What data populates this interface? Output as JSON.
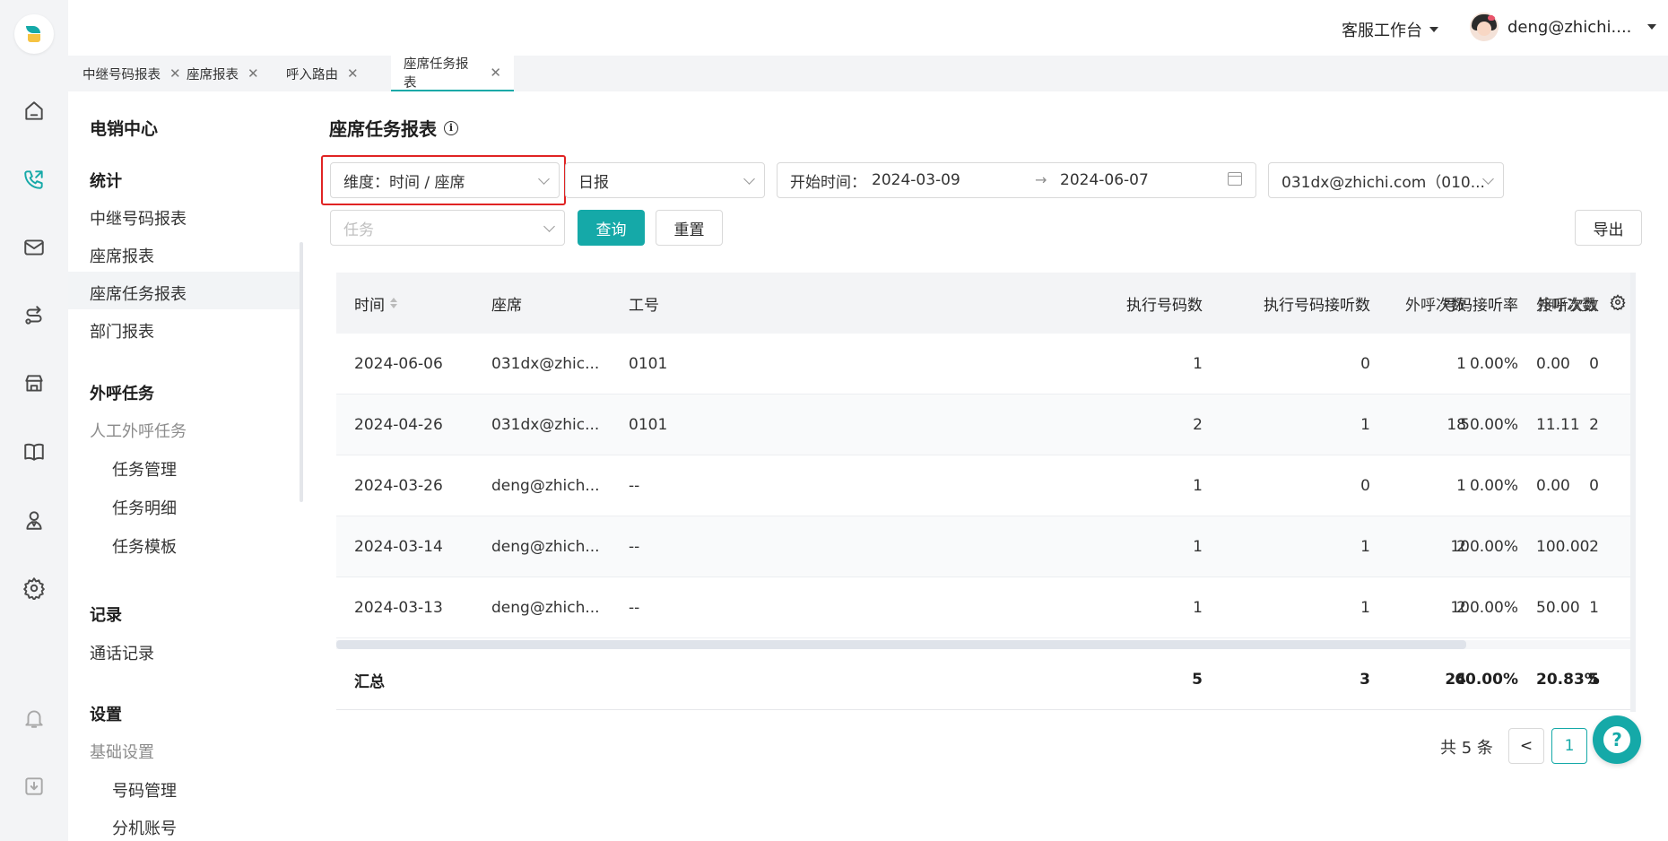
{
  "topbar": {
    "workbench": "客服工作台",
    "user": "deng@zhichi...."
  },
  "tabs": [
    {
      "label": "中继号码报表"
    },
    {
      "label": "座席报表"
    },
    {
      "label": "呼入路由"
    },
    {
      "label": "座席任务报表"
    }
  ],
  "tab_close": "✕",
  "menu": {
    "center": "电销中心",
    "stats_title": "统计",
    "stats_items": [
      "中继号码报表",
      "座席报表",
      "座席任务报表",
      "部门报表"
    ],
    "outbound_title": "外呼任务",
    "manual_outbound": "人工外呼任务",
    "manual_items": [
      "任务管理",
      "任务明细",
      "任务模板"
    ],
    "records_title": "记录",
    "records_items": [
      "通话记录"
    ],
    "settings_title": "设置",
    "basic_settings": "基础设置",
    "basic_items": [
      "号码管理",
      "分机账号"
    ]
  },
  "page": {
    "title": "座席任务报表",
    "info_icon": "i"
  },
  "filters": {
    "dimension": "维度：时间 / 座席",
    "period": "日报",
    "start_label": "开始时间：",
    "start_date": "2024-03-09",
    "arrow": "→",
    "end_date": "2024-06-07",
    "agent": "031dx@zhichi.com（010...",
    "task_placeholder": "任务",
    "query": "查询",
    "reset": "重置",
    "export": "导出"
  },
  "table": {
    "columns": [
      "时间",
      "座席",
      "工号",
      "执行号码数",
      "执行号码接听数",
      "号码接听率",
      "外呼次数",
      "接听次数",
      "外呼次数"
    ],
    "rows": [
      [
        "2024-06-06",
        "031dx@zhic...",
        "0101",
        "1",
        "0",
        "0.00%",
        "1",
        "0",
        "0.00"
      ],
      [
        "2024-04-26",
        "031dx@zhic...",
        "0101",
        "2",
        "1",
        "50.00%",
        "18",
        "2",
        "11.11"
      ],
      [
        "2024-03-26",
        "deng@zhich...",
        "--",
        "1",
        "0",
        "0.00%",
        "1",
        "0",
        "0.00"
      ],
      [
        "2024-03-14",
        "deng@zhich...",
        "--",
        "1",
        "1",
        "100.00%",
        "2",
        "2",
        "100.00"
      ],
      [
        "2024-03-13",
        "deng@zhich...",
        "--",
        "1",
        "1",
        "100.00%",
        "2",
        "1",
        "50.00"
      ]
    ],
    "summary": [
      "汇总",
      "",
      "",
      "5",
      "3",
      "60.00%",
      "24",
      "5",
      "20.83%"
    ]
  },
  "pagination": {
    "total": "共 5 条",
    "prev": "<",
    "current": "1"
  },
  "help": "?",
  "colors": {
    "accent": "#15a9a8",
    "highlight_border": "#e02424"
  }
}
